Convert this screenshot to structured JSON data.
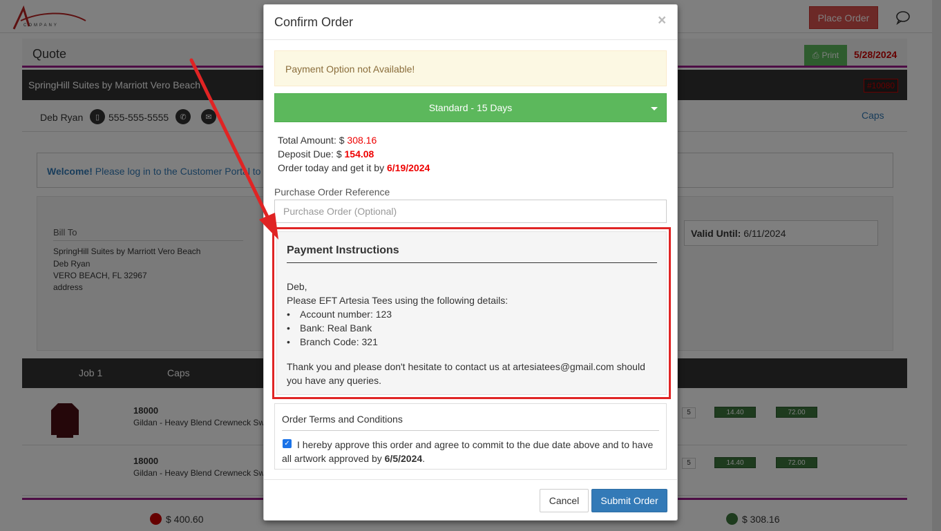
{
  "background": {
    "logo_text": "COMPANY",
    "place_order_label": "Place Order",
    "quote_title": "Quote",
    "print_label": "Print",
    "quote_date": "5/28/2024",
    "customer_name": "SpringHill Suites by Marriott Vero Beach",
    "quote_number": "#10080",
    "contact_name": "Deb Ryan",
    "contact_phone": "555-555-5555",
    "caps_link": "Caps",
    "welcome_bold": "Welcome!",
    "welcome_text": " Please log in to the Customer Portal to",
    "bill_to_label": "Bill To",
    "bill_lines": [
      "SpringHill Suites by Marriott Vero Beach",
      "Deb Ryan",
      "VERO BEACH, FL 32967",
      "address"
    ],
    "valid_until_label": "Valid Until:",
    "valid_until_value": "6/11/2024",
    "job_tabs": [
      "Job 1",
      "Caps"
    ],
    "items": [
      {
        "code": "18000",
        "desc": "Gildan - Heavy Blend Crewneck Sw",
        "qty": "5",
        "unit": "14.40",
        "total": "72.00"
      },
      {
        "code": "18000",
        "desc": "Gildan - Heavy Blend Crewneck Sw",
        "qty": "5",
        "unit": "14.40",
        "total": "72.00"
      }
    ],
    "totals": [
      "$ 400.60",
      "$ 308.16"
    ],
    "colors": {
      "accent_purple": "#9b1a8b",
      "danger": "#d9534f",
      "success": "#5cb85c",
      "primary": "#337ab7"
    }
  },
  "modal": {
    "title": "Confirm Order",
    "close_glyph": "×",
    "alert": "Payment Option not Available!",
    "term_selected": "Standard - 15 Days",
    "total_amount_label": "Total Amount: $ ",
    "total_amount_value": "308.16",
    "deposit_label": "Deposit Due: $ ",
    "deposit_value": "154.08",
    "order_today_label": "Order today and get it by ",
    "order_today_date": "6/19/2024",
    "po_label": "Purchase Order Reference",
    "po_placeholder": "Purchase Order (Optional)",
    "payment_title": "Payment Instructions",
    "payment_greeting": "Deb,",
    "payment_intro": "Please EFT Artesia Tees using the following details:",
    "payment_details": [
      "Account number: 123",
      "Bank: Real Bank",
      "Branch Code: 321"
    ],
    "payment_thanks": "Thank you and please don't hesitate to contact us at artesiatees@gmail.com should you have any queries.",
    "terms_title": "Order Terms and Conditions",
    "terms_text_before": "I hereby approve this order and agree to commit to the due date above and to have all artwork approved by ",
    "terms_date": "6/5/2024",
    "terms_text_after": ".",
    "terms_checked": true,
    "cancel_label": "Cancel",
    "submit_label": "Submit Order"
  },
  "annotation": {
    "color": "#e02424"
  }
}
